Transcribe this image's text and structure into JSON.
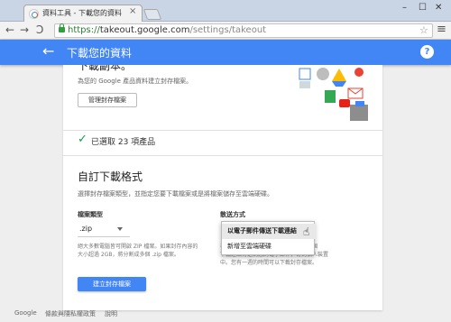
{
  "browser": {
    "tab_title": "資料工具 - 下載您的資料",
    "tab_close": "×",
    "window_controls": [
      "–",
      "☐",
      "✕"
    ],
    "url_scheme": "https://",
    "url_host": "takeout.google.com",
    "url_path": "/settings/takeout",
    "back": "←",
    "forward": "→",
    "reload": "C",
    "star": "☆",
    "menu": "≡"
  },
  "appbar": {
    "back": "←",
    "title": "下載您的資料",
    "help": "?"
  },
  "archive": {
    "heading_cutoff": "下載副本。",
    "description": "為您的 Google 產品資料建立封存檔案。",
    "manage_button": "管理封存檔案"
  },
  "selection": {
    "check": "✓",
    "text": "已選取 23 項產品"
  },
  "customize": {
    "title": "自訂下載格式",
    "intro": "選擇封存檔案類型，並指定您要下載檔案或是將檔案儲存至雲端硬碟。",
    "file_type_label": "檔案類型",
    "file_type_value": ".zip",
    "file_type_help": [
      "絕大多數電腦皆可開啟 ZIP 檔案。如果封存內容的",
      "大小超過 2GB，將分割成多個 .zip 檔案。"
    ],
    "delivery_label": "散送方式",
    "delivery_help": [
      "在封存完成後，我們會以電子郵件將一個",
      "下載連結傳送到您的電子郵件，寄到個人裝置",
      "中。您有一週的時間可以下載封存檔案。"
    ],
    "delivery_options": [
      "以電子郵件傳送下載連結",
      "新增至雲端硬碟"
    ],
    "create_button": "建立封存檔案"
  },
  "footer": [
    "Google",
    "條款與隱私權政策",
    "說明"
  ],
  "colors": {
    "accent": "#4285f4",
    "check": "#0f9d58"
  }
}
